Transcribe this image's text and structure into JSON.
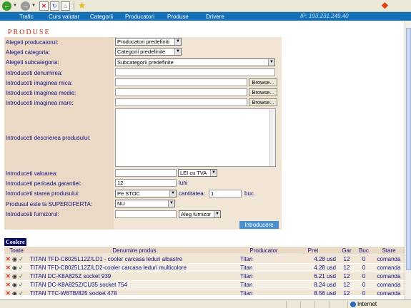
{
  "browser": {
    "back_icon": "back-arrow-icon",
    "forward_icon": "forward-arrow-icon",
    "stop_icon": "stop-icon",
    "refresh_icon": "refresh-icon",
    "home_icon": "home-icon",
    "favorites_icon": "star-icon",
    "logo_icon": "windows-logo-icon"
  },
  "nav": {
    "items": [
      "Trafic",
      "Curs valutar",
      "Categorii",
      "Producatori",
      "Produse",
      "Drivere"
    ],
    "ip": "IP:  193.231.249.40"
  },
  "form": {
    "heading": "PRODUSE",
    "producer_label": "Alegeti producatorul:",
    "producer_value": "Producatori predefiniti",
    "category_label": "Alegeti categoria:",
    "category_value": "Categorii predefinite",
    "subcategory_label": "Alegeti subcategoria:",
    "subcategory_value": "Subcategorii predefinite",
    "name_label": "Introduceti denumirea:",
    "img_small_label": "Introduceti imaginea mica:",
    "img_medium_label": "Introduceti imaginea medie:",
    "img_large_label": "Introduceti imaginea mare:",
    "browse_label": "Browse...",
    "description_label": "Introduceti descrierea produsului:",
    "value_label": "Introduceti valoarea:",
    "currency_value": "LEI cu TVA",
    "warranty_label": "Introduceti perioada garantiei:",
    "warranty_value": "12",
    "warranty_unit": "luni",
    "state_label": "Introduceti starea produsului:",
    "state_value": "Pe STOC",
    "quantity_label": "cantitatea:",
    "quantity_value": "1",
    "quantity_unit": "buc.",
    "superoffer_label": "Produsul este la SUPEROFERTA:",
    "superoffer_value": "NU",
    "supplier_label": "Introduceti furnizorul:",
    "supplier_select": "Aleg furnizor",
    "submit_label": "Introducere"
  },
  "table": {
    "title": "Coolere",
    "headers": [
      "Toate",
      "Denumire produs",
      "Producator",
      "Pret",
      "Gar",
      "Buc",
      "Stare"
    ],
    "rows": [
      {
        "name": "TITAN TFD-C8025L12Z/LD1 - cooler carcasa leduri albastre",
        "producer": "Titan",
        "price": "4.28 usd",
        "gar": "12",
        "buc": "0",
        "state": "comanda"
      },
      {
        "name": "TITAN TFD-C8025L12Z/LD2-cooler carcasa leduri multicolore",
        "producer": "Titan",
        "price": "4.28 usd",
        "gar": "12",
        "buc": "0",
        "state": "comanda"
      },
      {
        "name": "TITAN DC-K8A825Z socket 939",
        "producer": "Titan",
        "price": "6.21 usd",
        "gar": "12",
        "buc": "0",
        "state": "comanda"
      },
      {
        "name": "TITAN DC-K8A825Z/CU35 socket 754",
        "producer": "Titan",
        "price": "8.24 usd",
        "gar": "12",
        "buc": "0",
        "state": "comanda"
      },
      {
        "name": "TITAN TTC-W6TB/825 socket 478",
        "producer": "Titan",
        "price": "8.56 usd",
        "gar": "12",
        "buc": "0",
        "state": "comanda"
      }
    ]
  },
  "status": {
    "zone": "Internet"
  }
}
